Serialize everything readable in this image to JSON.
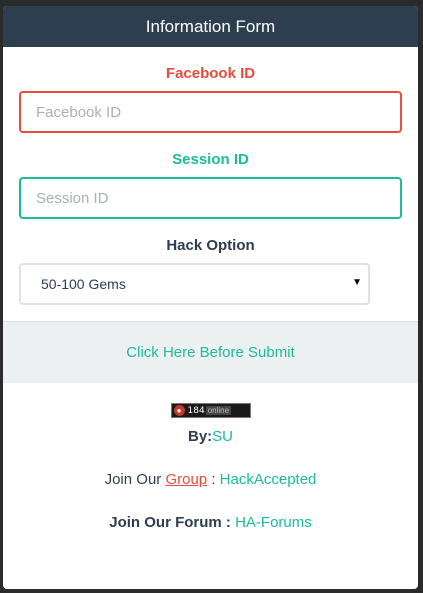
{
  "header": {
    "title": "Information Form"
  },
  "form": {
    "facebook_label": "Facebook ID",
    "facebook_placeholder": "Facebook ID",
    "session_label": "Session ID",
    "session_placeholder": "Session ID",
    "hack_label": "Hack Option",
    "hack_selected": "50-100 Gems"
  },
  "submit": {
    "label": "Click Here Before Submit"
  },
  "counter": {
    "count": "184",
    "suffix": "online"
  },
  "footer": {
    "by_prefix": "By:",
    "author": "SU",
    "group_prefix": "Join Our ",
    "group_link": "Group",
    "group_sep": " : ",
    "group_name": "HackAccepted",
    "forum_prefix": "Join Our Forum : ",
    "forum_name": "HA-Forums"
  },
  "colors": {
    "header_bg": "#2c3e50",
    "accent_red": "#e74c3c",
    "accent_teal": "#1abc9c",
    "text_dark": "#2c3e50",
    "submit_bg": "#ecf0f1"
  }
}
